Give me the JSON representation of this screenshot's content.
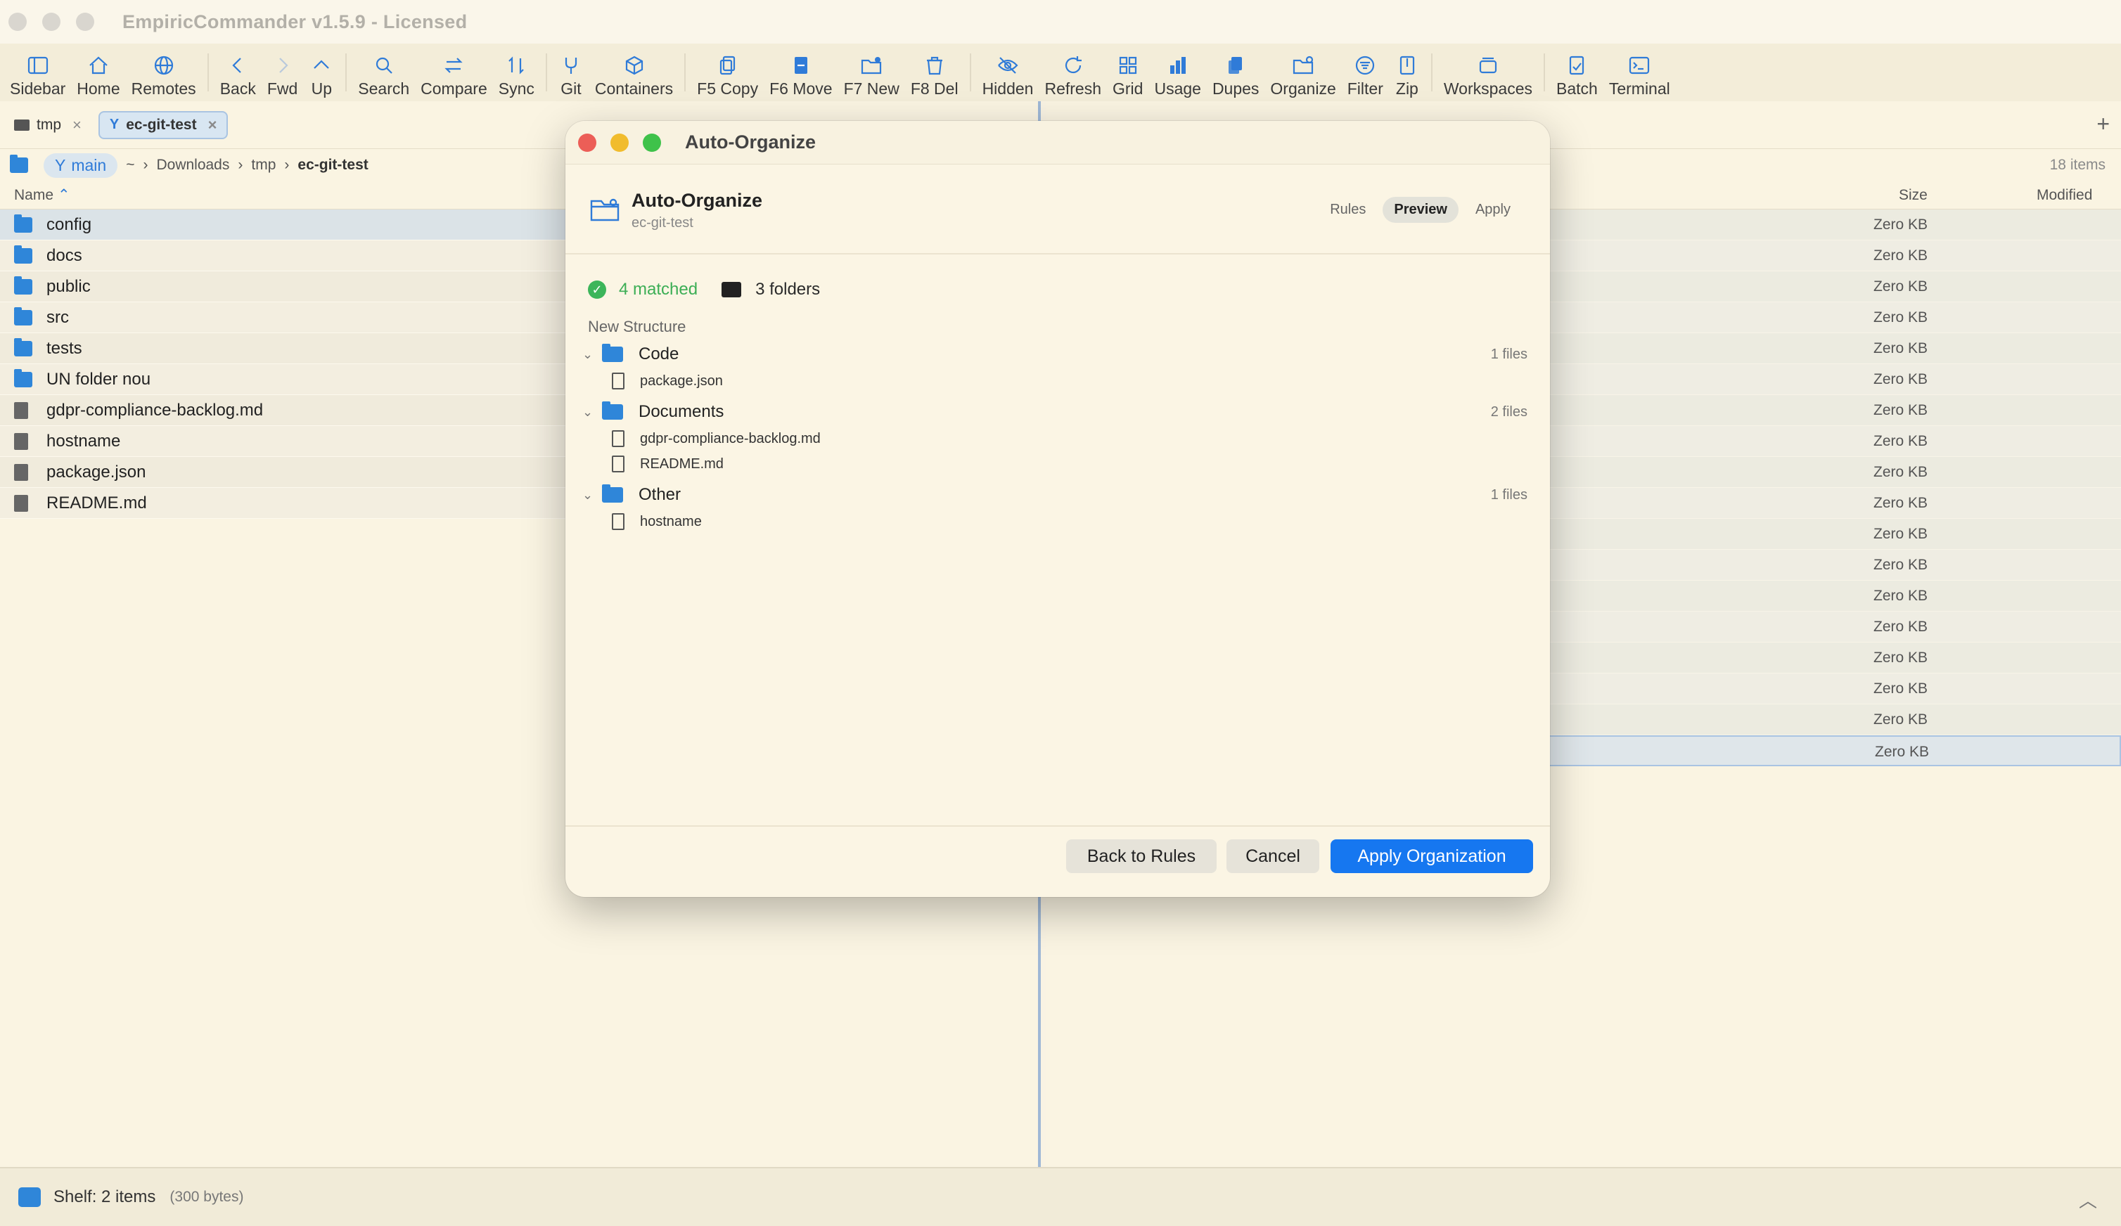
{
  "app": {
    "title": "EmpiricCommander v1.5.9 - Licensed"
  },
  "toolbar": [
    {
      "label": "Sidebar",
      "icon": "sidebar-icon"
    },
    {
      "label": "Home",
      "icon": "home-icon"
    },
    {
      "label": "Remotes",
      "icon": "globe-icon"
    },
    {
      "label": "Back",
      "icon": "chevron-left-icon"
    },
    {
      "label": "Fwd",
      "icon": "chevron-right-icon"
    },
    {
      "label": "Up",
      "icon": "chevron-up-icon"
    },
    {
      "label": "Search",
      "icon": "search-icon"
    },
    {
      "label": "Compare",
      "icon": "compare-icon"
    },
    {
      "label": "Sync",
      "icon": "sync-icon"
    },
    {
      "label": "Git",
      "icon": "git-branch-icon"
    },
    {
      "label": "Containers",
      "icon": "box-icon"
    },
    {
      "label": "F5 Copy",
      "icon": "copy-icon"
    },
    {
      "label": "F6 Move",
      "icon": "move-icon"
    },
    {
      "label": "F7 New",
      "icon": "new-folder-icon"
    },
    {
      "label": "F8 Del",
      "icon": "trash-icon"
    },
    {
      "label": "Hidden",
      "icon": "eye-slash-icon"
    },
    {
      "label": "Refresh",
      "icon": "refresh-icon"
    },
    {
      "label": "Grid",
      "icon": "grid-icon"
    },
    {
      "label": "Usage",
      "icon": "bar-chart-icon"
    },
    {
      "label": "Dupes",
      "icon": "duplicate-icon"
    },
    {
      "label": "Organize",
      "icon": "organize-icon"
    },
    {
      "label": "Filter",
      "icon": "filter-icon"
    },
    {
      "label": "Zip",
      "icon": "zip-icon"
    },
    {
      "label": "Workspaces",
      "icon": "workspaces-icon"
    },
    {
      "label": "Batch",
      "icon": "batch-icon"
    },
    {
      "label": "Terminal",
      "icon": "terminal-icon"
    }
  ],
  "left_panel": {
    "tabs": [
      {
        "label": "tmp",
        "active": false
      },
      {
        "label": "ec-git-test",
        "active": true
      }
    ],
    "branch": "main",
    "path": {
      "home": "~",
      "parts": [
        "Downloads",
        "tmp"
      ],
      "current": "ec-git-test"
    },
    "column_name": "Name",
    "files": [
      {
        "name": "config",
        "type": "folder"
      },
      {
        "name": "docs",
        "type": "folder"
      },
      {
        "name": "public",
        "type": "folder"
      },
      {
        "name": "src",
        "type": "folder"
      },
      {
        "name": "tests",
        "type": "folder"
      },
      {
        "name": "UN folder nou",
        "type": "folder"
      },
      {
        "name": "gdpr-compliance-backlog.md",
        "type": "file"
      },
      {
        "name": "hostname",
        "type": "file"
      },
      {
        "name": "package.json",
        "type": "file"
      },
      {
        "name": "README.md",
        "type": "file"
      }
    ]
  },
  "right_panel": {
    "plus": "+",
    "item_count": "18 items",
    "col_size": "Size",
    "col_modified": "Modified",
    "sizes": [
      "Zero KB",
      "Zero KB",
      "Zero KB",
      "Zero KB",
      "Zero KB",
      "Zero KB",
      "Zero KB",
      "Zero KB",
      "Zero KB",
      "Zero KB",
      "Zero KB",
      "Zero KB",
      "Zero KB",
      "Zero KB",
      "Zero KB",
      "Zero KB",
      "Zero KB",
      "Zero KB"
    ]
  },
  "statusbar": {
    "shelf": "Shelf: 2 items",
    "bytes": "(300 bytes)"
  },
  "modal": {
    "window_title": "Auto-Organize",
    "title": "Auto-Organize",
    "subtitle": "ec-git-test",
    "steps": [
      "Rules",
      "Preview",
      "Apply"
    ],
    "active_step": "Preview",
    "matched": "4 matched",
    "folders": "3 folders",
    "section": "New Structure",
    "groups": [
      {
        "name": "Code",
        "count": "1 files",
        "files": [
          "package.json"
        ]
      },
      {
        "name": "Documents",
        "count": "2 files",
        "files": [
          "gdpr-compliance-backlog.md",
          "README.md"
        ]
      },
      {
        "name": "Other",
        "count": "1 files",
        "files": [
          "hostname"
        ]
      }
    ],
    "buttons": {
      "back": "Back to Rules",
      "cancel": "Cancel",
      "apply": "Apply Organization"
    },
    "colors": {
      "accent": "#1677f0",
      "matched": "#3cae55",
      "close": "#ec5e57",
      "minimize": "#f1bc2d",
      "zoom": "#3fc24a"
    }
  }
}
